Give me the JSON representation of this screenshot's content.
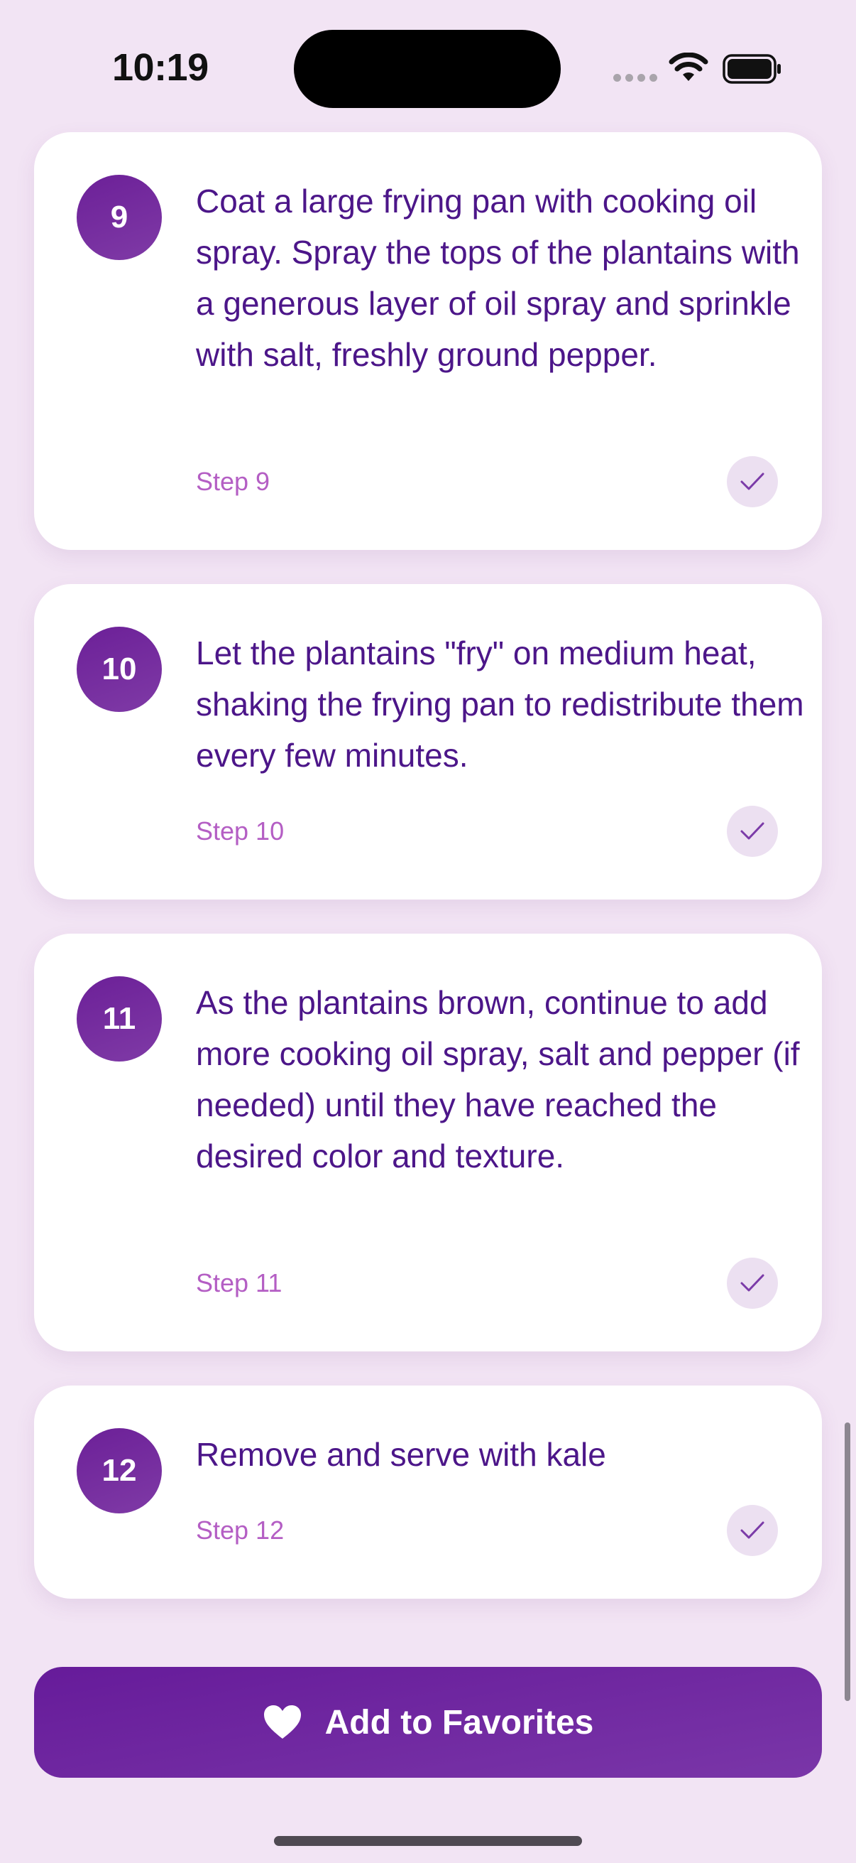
{
  "status_bar": {
    "time": "10:19"
  },
  "steps": [
    {
      "number": "9",
      "text": "Coat a large frying pan with cooking oil spray. Spray the tops of the plantains with a generous layer of oil spray and sprinkle with salt, freshly ground pepper.",
      "label": "Step 9"
    },
    {
      "number": "10",
      "text": "Let the plantains \"fry\" on medium heat, shaking the frying pan to redistribute them every few minutes.",
      "label": "Step 10"
    },
    {
      "number": "11",
      "text": "As the plantains brown, continue to add more cooking oil spray, salt and pepper (if needed) until they have reached the desired color and texture.",
      "label": "Step 11"
    },
    {
      "number": "12",
      "text": "Remove and serve with kale",
      "label": "Step 12"
    }
  ],
  "favorites_button": {
    "label": "Add to Favorites",
    "icon": "heart-icon"
  },
  "colors": {
    "background": "#f2e4f4",
    "accent": "#6c2098",
    "step_text": "#4c1689",
    "step_label": "#b45ec4"
  }
}
